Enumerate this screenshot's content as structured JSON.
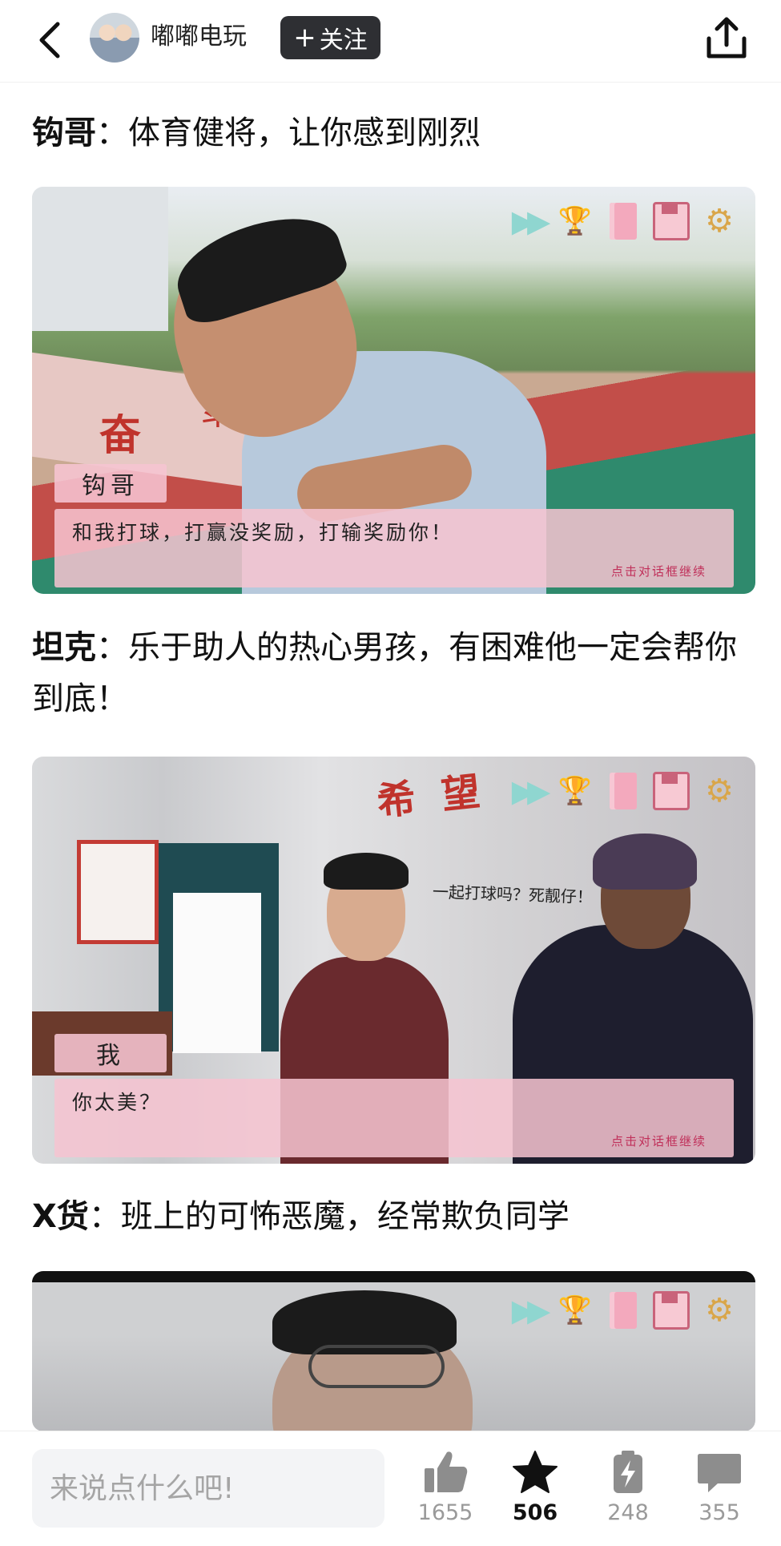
{
  "header": {
    "author": "嘟嘟电玩",
    "follow_label": "关注",
    "follow_plus": "+"
  },
  "sections": [
    {
      "title_name": "钩哥",
      "title_desc": "：体育健将，让你感到刚烈",
      "scene": {
        "wall_text_1": "奋",
        "wall_text_2": "斗",
        "speaker": "钩哥",
        "dialog": "和我打球，打赢没奖励，打输奖励你！",
        "hint": "点击对话框继续"
      }
    },
    {
      "title_name": "坦克",
      "title_desc": "：乐于助人的热心男孩，有困难他一定会帮你到底！",
      "scene": {
        "wall_text": "希 望",
        "speech": "一起打球吗？死靓仔！",
        "speaker": "我",
        "dialog": "你太美？",
        "hint": "点击对话框继续"
      }
    },
    {
      "title_name": "X货",
      "title_desc": "：班上的可怖恶魔，经常欺负同学"
    }
  ],
  "hud_icons": [
    "fast-forward-icon",
    "trophy-icon",
    "notebook-icon",
    "save-icon",
    "gear-icon"
  ],
  "footer": {
    "comment_placeholder": "来说点什么吧!",
    "likes": "1655",
    "favorites": "506",
    "shares": "248",
    "comments": "355"
  },
  "colors": {
    "dialog_pink": "#f6c4d1",
    "follow_bg": "#2e2f33",
    "hint_red": "#c0305a"
  }
}
